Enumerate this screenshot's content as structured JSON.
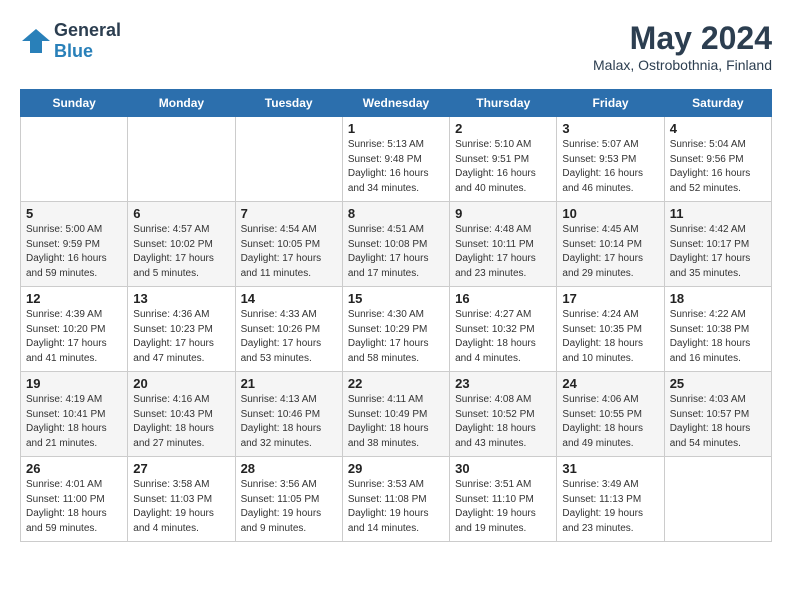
{
  "header": {
    "logo_general": "General",
    "logo_blue": "Blue",
    "month_year": "May 2024",
    "location": "Malax, Ostrobothnia, Finland"
  },
  "weekdays": [
    "Sunday",
    "Monday",
    "Tuesday",
    "Wednesday",
    "Thursday",
    "Friday",
    "Saturday"
  ],
  "weeks": [
    [
      {
        "day": "",
        "sunrise": "",
        "sunset": "",
        "daylight": ""
      },
      {
        "day": "",
        "sunrise": "",
        "sunset": "",
        "daylight": ""
      },
      {
        "day": "",
        "sunrise": "",
        "sunset": "",
        "daylight": ""
      },
      {
        "day": "1",
        "sunrise": "Sunrise: 5:13 AM",
        "sunset": "Sunset: 9:48 PM",
        "daylight": "Daylight: 16 hours and 34 minutes."
      },
      {
        "day": "2",
        "sunrise": "Sunrise: 5:10 AM",
        "sunset": "Sunset: 9:51 PM",
        "daylight": "Daylight: 16 hours and 40 minutes."
      },
      {
        "day": "3",
        "sunrise": "Sunrise: 5:07 AM",
        "sunset": "Sunset: 9:53 PM",
        "daylight": "Daylight: 16 hours and 46 minutes."
      },
      {
        "day": "4",
        "sunrise": "Sunrise: 5:04 AM",
        "sunset": "Sunset: 9:56 PM",
        "daylight": "Daylight: 16 hours and 52 minutes."
      }
    ],
    [
      {
        "day": "5",
        "sunrise": "Sunrise: 5:00 AM",
        "sunset": "Sunset: 9:59 PM",
        "daylight": "Daylight: 16 hours and 59 minutes."
      },
      {
        "day": "6",
        "sunrise": "Sunrise: 4:57 AM",
        "sunset": "Sunset: 10:02 PM",
        "daylight": "Daylight: 17 hours and 5 minutes."
      },
      {
        "day": "7",
        "sunrise": "Sunrise: 4:54 AM",
        "sunset": "Sunset: 10:05 PM",
        "daylight": "Daylight: 17 hours and 11 minutes."
      },
      {
        "day": "8",
        "sunrise": "Sunrise: 4:51 AM",
        "sunset": "Sunset: 10:08 PM",
        "daylight": "Daylight: 17 hours and 17 minutes."
      },
      {
        "day": "9",
        "sunrise": "Sunrise: 4:48 AM",
        "sunset": "Sunset: 10:11 PM",
        "daylight": "Daylight: 17 hours and 23 minutes."
      },
      {
        "day": "10",
        "sunrise": "Sunrise: 4:45 AM",
        "sunset": "Sunset: 10:14 PM",
        "daylight": "Daylight: 17 hours and 29 minutes."
      },
      {
        "day": "11",
        "sunrise": "Sunrise: 4:42 AM",
        "sunset": "Sunset: 10:17 PM",
        "daylight": "Daylight: 17 hours and 35 minutes."
      }
    ],
    [
      {
        "day": "12",
        "sunrise": "Sunrise: 4:39 AM",
        "sunset": "Sunset: 10:20 PM",
        "daylight": "Daylight: 17 hours and 41 minutes."
      },
      {
        "day": "13",
        "sunrise": "Sunrise: 4:36 AM",
        "sunset": "Sunset: 10:23 PM",
        "daylight": "Daylight: 17 hours and 47 minutes."
      },
      {
        "day": "14",
        "sunrise": "Sunrise: 4:33 AM",
        "sunset": "Sunset: 10:26 PM",
        "daylight": "Daylight: 17 hours and 53 minutes."
      },
      {
        "day": "15",
        "sunrise": "Sunrise: 4:30 AM",
        "sunset": "Sunset: 10:29 PM",
        "daylight": "Daylight: 17 hours and 58 minutes."
      },
      {
        "day": "16",
        "sunrise": "Sunrise: 4:27 AM",
        "sunset": "Sunset: 10:32 PM",
        "daylight": "Daylight: 18 hours and 4 minutes."
      },
      {
        "day": "17",
        "sunrise": "Sunrise: 4:24 AM",
        "sunset": "Sunset: 10:35 PM",
        "daylight": "Daylight: 18 hours and 10 minutes."
      },
      {
        "day": "18",
        "sunrise": "Sunrise: 4:22 AM",
        "sunset": "Sunset: 10:38 PM",
        "daylight": "Daylight: 18 hours and 16 minutes."
      }
    ],
    [
      {
        "day": "19",
        "sunrise": "Sunrise: 4:19 AM",
        "sunset": "Sunset: 10:41 PM",
        "daylight": "Daylight: 18 hours and 21 minutes."
      },
      {
        "day": "20",
        "sunrise": "Sunrise: 4:16 AM",
        "sunset": "Sunset: 10:43 PM",
        "daylight": "Daylight: 18 hours and 27 minutes."
      },
      {
        "day": "21",
        "sunrise": "Sunrise: 4:13 AM",
        "sunset": "Sunset: 10:46 PM",
        "daylight": "Daylight: 18 hours and 32 minutes."
      },
      {
        "day": "22",
        "sunrise": "Sunrise: 4:11 AM",
        "sunset": "Sunset: 10:49 PM",
        "daylight": "Daylight: 18 hours and 38 minutes."
      },
      {
        "day": "23",
        "sunrise": "Sunrise: 4:08 AM",
        "sunset": "Sunset: 10:52 PM",
        "daylight": "Daylight: 18 hours and 43 minutes."
      },
      {
        "day": "24",
        "sunrise": "Sunrise: 4:06 AM",
        "sunset": "Sunset: 10:55 PM",
        "daylight": "Daylight: 18 hours and 49 minutes."
      },
      {
        "day": "25",
        "sunrise": "Sunrise: 4:03 AM",
        "sunset": "Sunset: 10:57 PM",
        "daylight": "Daylight: 18 hours and 54 minutes."
      }
    ],
    [
      {
        "day": "26",
        "sunrise": "Sunrise: 4:01 AM",
        "sunset": "Sunset: 11:00 PM",
        "daylight": "Daylight: 18 hours and 59 minutes."
      },
      {
        "day": "27",
        "sunrise": "Sunrise: 3:58 AM",
        "sunset": "Sunset: 11:03 PM",
        "daylight": "Daylight: 19 hours and 4 minutes."
      },
      {
        "day": "28",
        "sunrise": "Sunrise: 3:56 AM",
        "sunset": "Sunset: 11:05 PM",
        "daylight": "Daylight: 19 hours and 9 minutes."
      },
      {
        "day": "29",
        "sunrise": "Sunrise: 3:53 AM",
        "sunset": "Sunset: 11:08 PM",
        "daylight": "Daylight: 19 hours and 14 minutes."
      },
      {
        "day": "30",
        "sunrise": "Sunrise: 3:51 AM",
        "sunset": "Sunset: 11:10 PM",
        "daylight": "Daylight: 19 hours and 19 minutes."
      },
      {
        "day": "31",
        "sunrise": "Sunrise: 3:49 AM",
        "sunset": "Sunset: 11:13 PM",
        "daylight": "Daylight: 19 hours and 23 minutes."
      },
      {
        "day": "",
        "sunrise": "",
        "sunset": "",
        "daylight": ""
      }
    ]
  ]
}
